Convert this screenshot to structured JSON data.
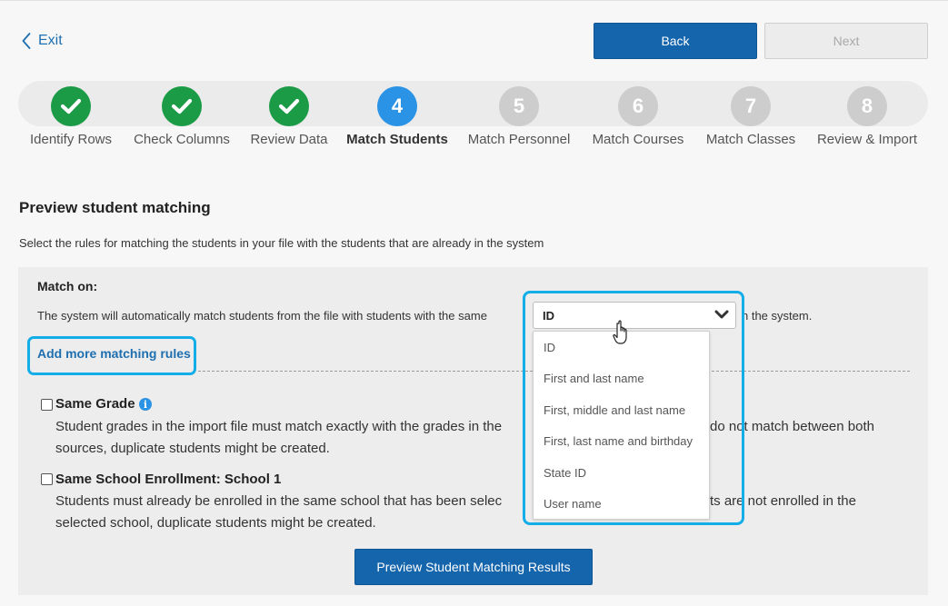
{
  "header": {
    "exit_label": "Exit",
    "back_label": "Back",
    "next_label": "Next"
  },
  "steps": [
    {
      "number": "1",
      "label": "Identify Rows",
      "state": "done"
    },
    {
      "number": "2",
      "label": "Check Columns",
      "state": "done"
    },
    {
      "number": "3",
      "label": "Review Data",
      "state": "done"
    },
    {
      "number": "4",
      "label": "Match Students",
      "state": "current"
    },
    {
      "number": "5",
      "label": "Match Personnel",
      "state": "todo"
    },
    {
      "number": "6",
      "label": "Match Courses",
      "state": "todo"
    },
    {
      "number": "7",
      "label": "Match Classes",
      "state": "todo"
    },
    {
      "number": "8",
      "label": "Review & Import",
      "state": "todo"
    }
  ],
  "section": {
    "title": "Preview student matching",
    "description": "Select the rules for matching the students in your file with the students that are already in the system"
  },
  "match": {
    "heading": "Match on:",
    "text_before": "The system will automatically match students from the file with students with the same",
    "text_after": "n the system.",
    "selected": "ID",
    "options": [
      "ID",
      "First and last name",
      "First, middle and last name",
      "First, last name and birthday",
      "State ID",
      "User name"
    ],
    "add_rules_label": "Add more matching rules"
  },
  "rules": [
    {
      "title": "Same Grade",
      "desc_line1": "Student grades in the import file must match exactly with the grades in the",
      "desc_line1_end": "do not match between both",
      "desc_line2": "sources, duplicate students might be created."
    },
    {
      "title": "Same School Enrollment: School 1",
      "desc_line1": "Students must already be enrolled in the same school that has been selec",
      "desc_line1_end": "ts are not enrolled in the",
      "desc_line2": "selected school, duplicate students might be created."
    }
  ],
  "preview_button": "Preview Student Matching Results",
  "colors": {
    "primary": "#1565ad",
    "step_done": "#1c9b47",
    "step_current": "#2a93e5",
    "step_todo": "#cdcdcd",
    "highlight": "#13aee7"
  }
}
